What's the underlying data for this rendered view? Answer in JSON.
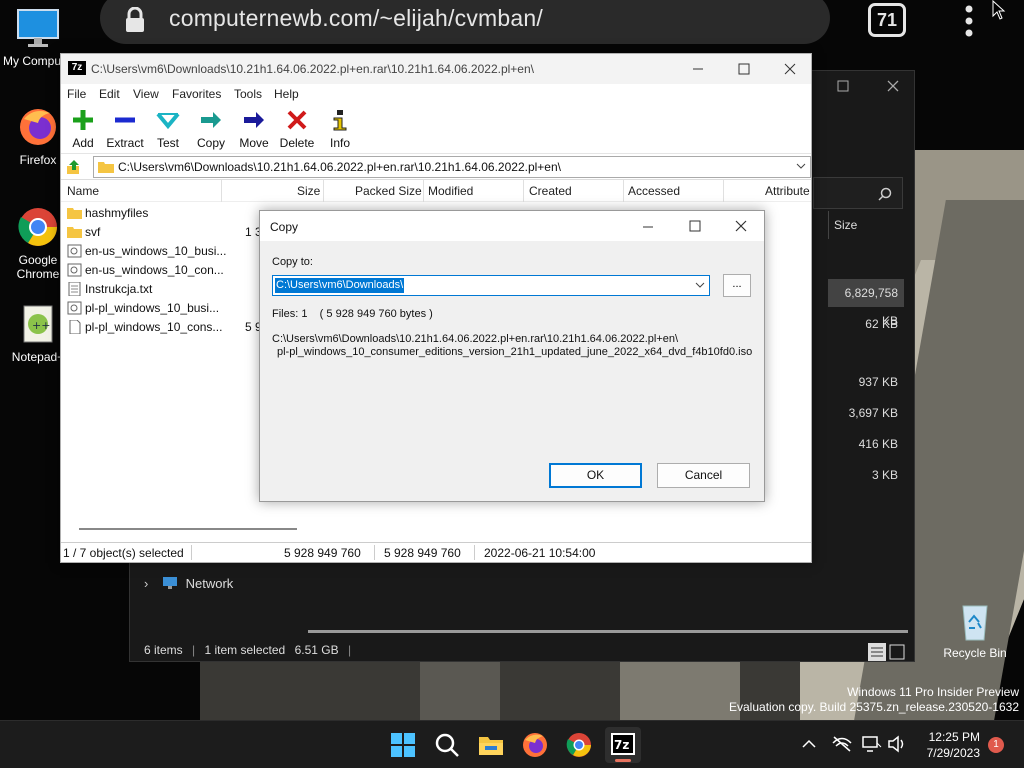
{
  "browser": {
    "url": "computernewb.com/~elijah/cvmban/",
    "tab_count": "71"
  },
  "desktop_icons": [
    {
      "name": "my-computer",
      "label": "My Compu"
    },
    {
      "name": "firefox",
      "label": "Firefox"
    },
    {
      "name": "google-chrome",
      "label": "Google Chrome"
    },
    {
      "name": "notepad-plus-plus",
      "label": "Notepad+"
    },
    {
      "name": "recycle-bin",
      "label": "Recycle Bin"
    }
  ],
  "explorer": {
    "size_header": "Size",
    "sizes": [
      "6,829,758 KB",
      "62 KB",
      "937 KB",
      "3,697 KB",
      "416 KB",
      "3 KB"
    ],
    "network_label": "Network",
    "status": {
      "items": "6 items",
      "selected": "1 item selected",
      "size": "6.51 GB"
    }
  },
  "sevenzip": {
    "title": "C:\\Users\\vm6\\Downloads\\10.21h1.64.06.2022.pl+en.rar\\10.21h1.64.06.2022.pl+en\\",
    "app_icon_label": "7z",
    "menu": [
      "File",
      "Edit",
      "View",
      "Favorites",
      "Tools",
      "Help"
    ],
    "toolbar": [
      "Add",
      "Extract",
      "Test",
      "Copy",
      "Move",
      "Delete",
      "Info"
    ],
    "address": "C:\\Users\\vm6\\Downloads\\10.21h1.64.06.2022.pl+en.rar\\10.21h1.64.06.2022.pl+en\\",
    "columns": [
      "Name",
      "Size",
      "Packed Size",
      "Modified",
      "Created",
      "Accessed",
      "Attribute"
    ],
    "files": [
      {
        "name": "hashmyfiles",
        "type": "folder",
        "size": ""
      },
      {
        "name": "svf",
        "type": "folder",
        "size": "1 3"
      },
      {
        "name": "en-us_windows_10_busi...",
        "type": "iso",
        "size": ""
      },
      {
        "name": "en-us_windows_10_con...",
        "type": "iso",
        "size": ""
      },
      {
        "name": "Instrukcja.txt",
        "type": "txt",
        "size": ""
      },
      {
        "name": "pl-pl_windows_10_busi...",
        "type": "iso",
        "size": ""
      },
      {
        "name": "pl-pl_windows_10_cons...",
        "type": "file",
        "size": "5 9"
      }
    ],
    "status": {
      "selected": "1 / 7 object(s) selected",
      "size": "5 928 949 760",
      "packed": "5 928 949 760",
      "modified": "2022-06-21 10:54:00"
    }
  },
  "copy_dialog": {
    "title": "Copy",
    "copy_to_label": "Copy to:",
    "destination": "C:\\Users\\vm6\\Downloads\\",
    "browse_label": "...",
    "files_info": "Files: 1    ( 5 928 949 760 bytes )",
    "source_path_1": "C:\\Users\\vm6\\Downloads\\10.21h1.64.06.2022.pl+en.rar\\10.21h1.64.06.2022.pl+en\\",
    "source_path_2": "pl-pl_windows_10_consumer_editions_version_21h1_updated_june_2022_x64_dvd_f4b10fd0.iso",
    "ok_label": "OK",
    "cancel_label": "Cancel"
  },
  "watermark": {
    "line1": "Windows 11 Pro Insider Preview",
    "line2": "Evaluation copy. Build 25375.zn_release.230520-1632"
  },
  "taskbar": {
    "time": "12:25 PM",
    "date": "7/29/2023",
    "notification_count": "1"
  }
}
